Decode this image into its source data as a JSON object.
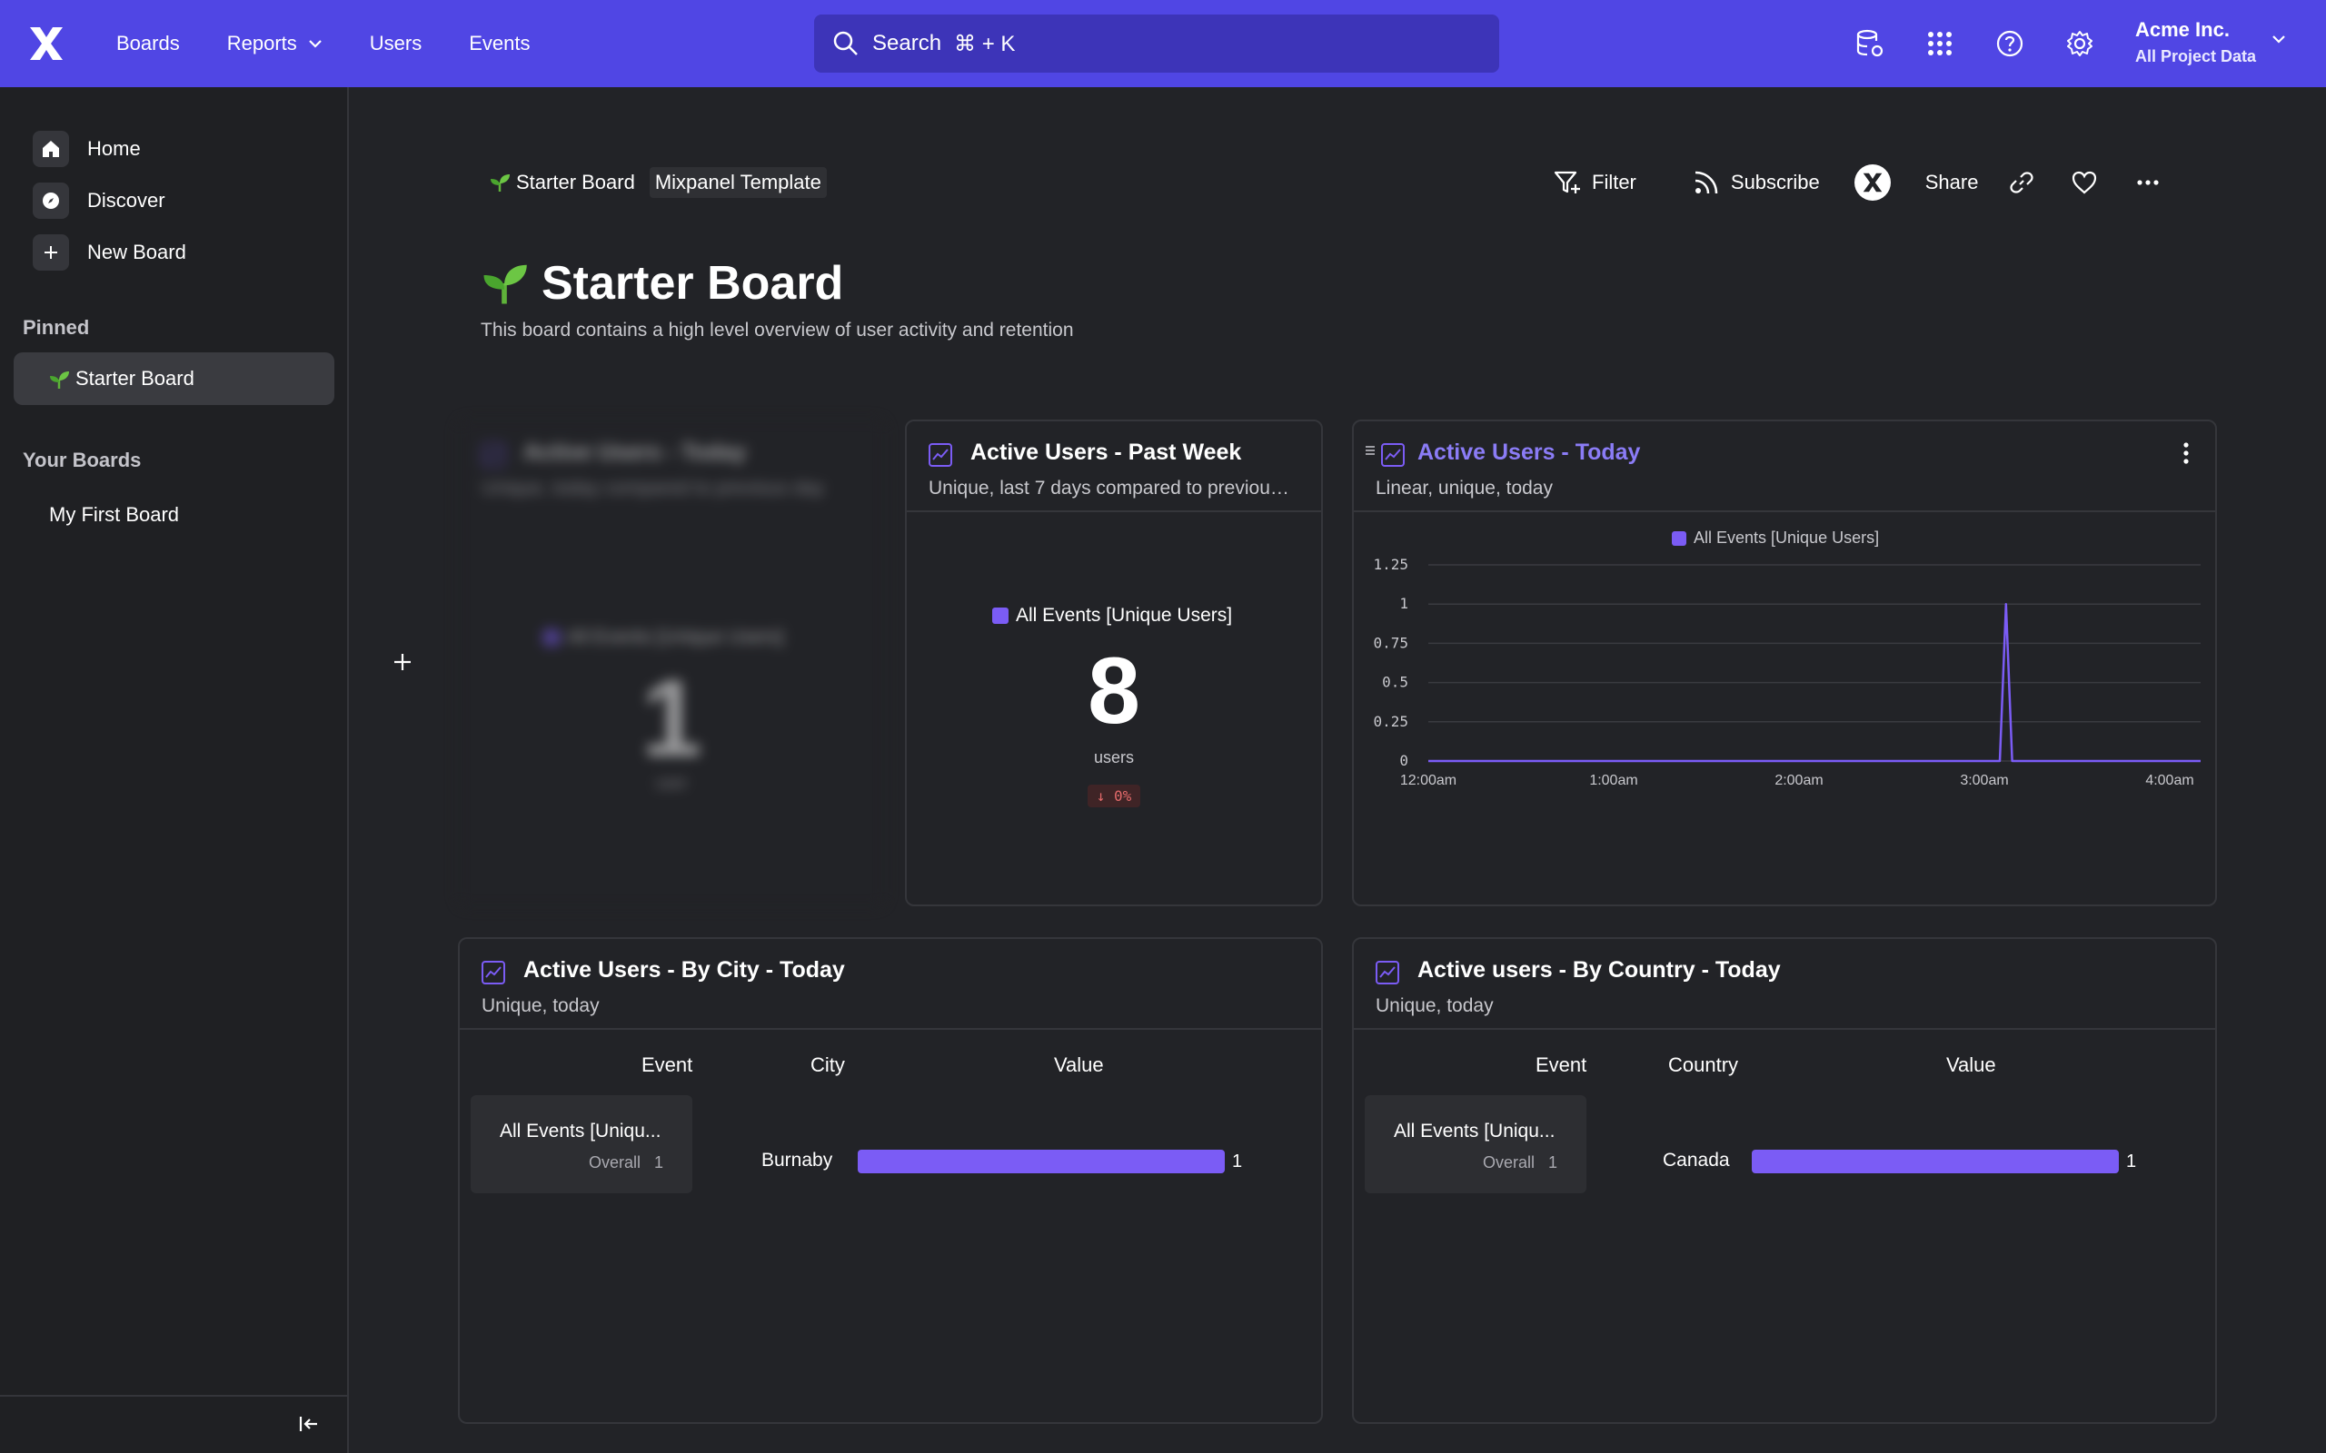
{
  "nav": {
    "boards": "Boards",
    "reports": "Reports",
    "users": "Users",
    "events": "Events",
    "search_placeholder": "Search",
    "search_shortcut": "⌘ + K",
    "org_name": "Acme Inc.",
    "org_project": "All Project Data"
  },
  "sidebar": {
    "home": "Home",
    "discover": "Discover",
    "new_board": "New Board",
    "pinned_label": "Pinned",
    "pinned_board": "Starter Board",
    "your_boards_label": "Your Boards",
    "boards": [
      "My First Board"
    ]
  },
  "board": {
    "breadcrumb": "Starter Board",
    "template_tag": "Mixpanel Template",
    "title": "Starter Board",
    "description": "This board contains a high level overview of user activity and retention",
    "actions": {
      "filter": "Filter",
      "subscribe": "Subscribe",
      "share": "Share"
    }
  },
  "cards": {
    "blurred": {
      "title": "Active Users - Today",
      "subtitle": "Unique, today compared to previous day",
      "legend": "All Events [Unique Users]",
      "value": "1",
      "units": "user"
    },
    "week": {
      "title": "Active Users - Past Week",
      "subtitle": "Unique, last 7 days compared to previou…",
      "legend": "All Events [Unique Users]",
      "value": "8",
      "units": "users",
      "delta": "↓ 0%"
    },
    "today": {
      "title": "Active Users - Today",
      "subtitle": "Linear, unique, today",
      "legend": "All Events [Unique Users]"
    },
    "city": {
      "title": "Active Users - By City - Today",
      "subtitle": "Unique, today",
      "col_event": "Event",
      "col_group": "City",
      "col_value": "Value",
      "event_name": "All Events [Uniqu...",
      "overall_label": "Overall",
      "overall_value": "1",
      "row_name": "Burnaby",
      "row_value": "1"
    },
    "country": {
      "title": "Active users - By Country - Today",
      "subtitle": "Unique, today",
      "col_event": "Event",
      "col_group": "Country",
      "col_value": "Value",
      "event_name": "All Events [Uniqu...",
      "overall_label": "Overall",
      "overall_value": "1",
      "row_name": "Canada",
      "row_value": "1"
    }
  },
  "chart_data": {
    "type": "line",
    "title": "Active Users - Today",
    "series": [
      {
        "name": "All Events [Unique Users]",
        "color": "#7b5cf5",
        "points": [
          {
            "t": "12:00am",
            "y": 0
          },
          {
            "t": "3:05am",
            "y": 0
          },
          {
            "t": "3:07am",
            "y": 1
          },
          {
            "t": "3:09am",
            "y": 0
          },
          {
            "t": "4:10am",
            "y": 0
          }
        ]
      }
    ],
    "y_ticks": [
      "1.25",
      "1",
      "0.75",
      "0.5",
      "0.25",
      "0"
    ],
    "x_ticks": [
      "12:00am",
      "1:00am",
      "2:00am",
      "3:00am",
      "4:00am"
    ],
    "ylim": [
      0,
      1.25
    ],
    "grid": true,
    "legend_position": "top-center"
  },
  "colors": {
    "topbar": "#5046e4",
    "accent": "#7b5cf5",
    "background": "#222327"
  }
}
